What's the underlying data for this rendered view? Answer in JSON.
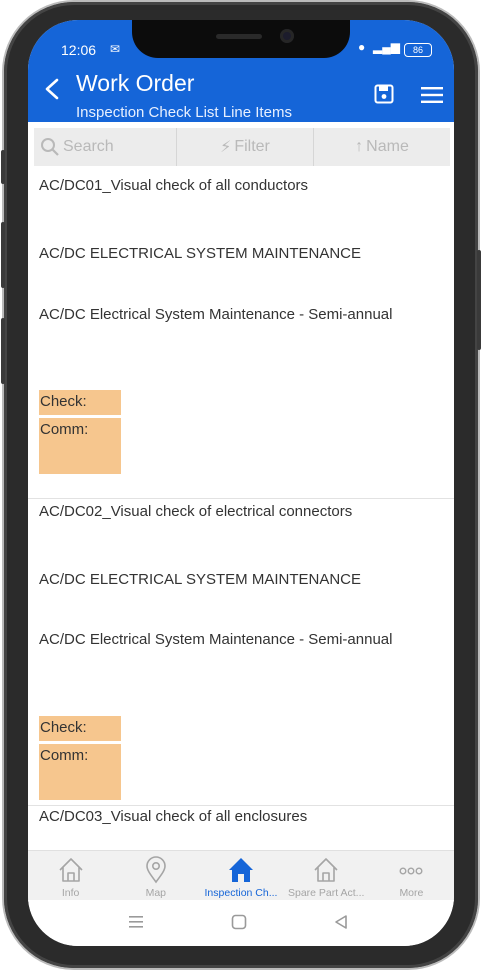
{
  "status": {
    "time": "12:06",
    "battery": "86"
  },
  "header": {
    "title": "Work Order",
    "subtitle": "Inspection Check List Line Items"
  },
  "toolbar": {
    "search": "Search",
    "filter": "Filter",
    "sort": "Name"
  },
  "items": [
    {
      "code": "AC/DC01_Visual check of all conductors",
      "category": "AC/DC ELECTRICAL SYSTEM MAINTENANCE",
      "plan": "AC/DC Electrical System Maintenance - Semi-annual",
      "check_label": "Check:",
      "comm_label": "Comm:"
    },
    {
      "code": "AC/DC02_Visual check of electrical connectors",
      "category": "AC/DC ELECTRICAL SYSTEM MAINTENANCE",
      "plan": "AC/DC Electrical System Maintenance - Semi-annual",
      "check_label": "Check:",
      "comm_label": "Comm:"
    },
    {
      "code": "AC/DC03_Visual check of all enclosures"
    }
  ],
  "tabs": [
    {
      "label": "Info",
      "icon": "home-icon"
    },
    {
      "label": "Map",
      "icon": "map-pin-icon"
    },
    {
      "label": "Inspection Ch...",
      "icon": "home-icon",
      "active": true
    },
    {
      "label": "Spare Part Act...",
      "icon": "home-icon"
    },
    {
      "label": "More",
      "icon": "more-icon"
    }
  ],
  "colors": {
    "accent": "#1565d8",
    "highlight": "#f6c68e"
  }
}
